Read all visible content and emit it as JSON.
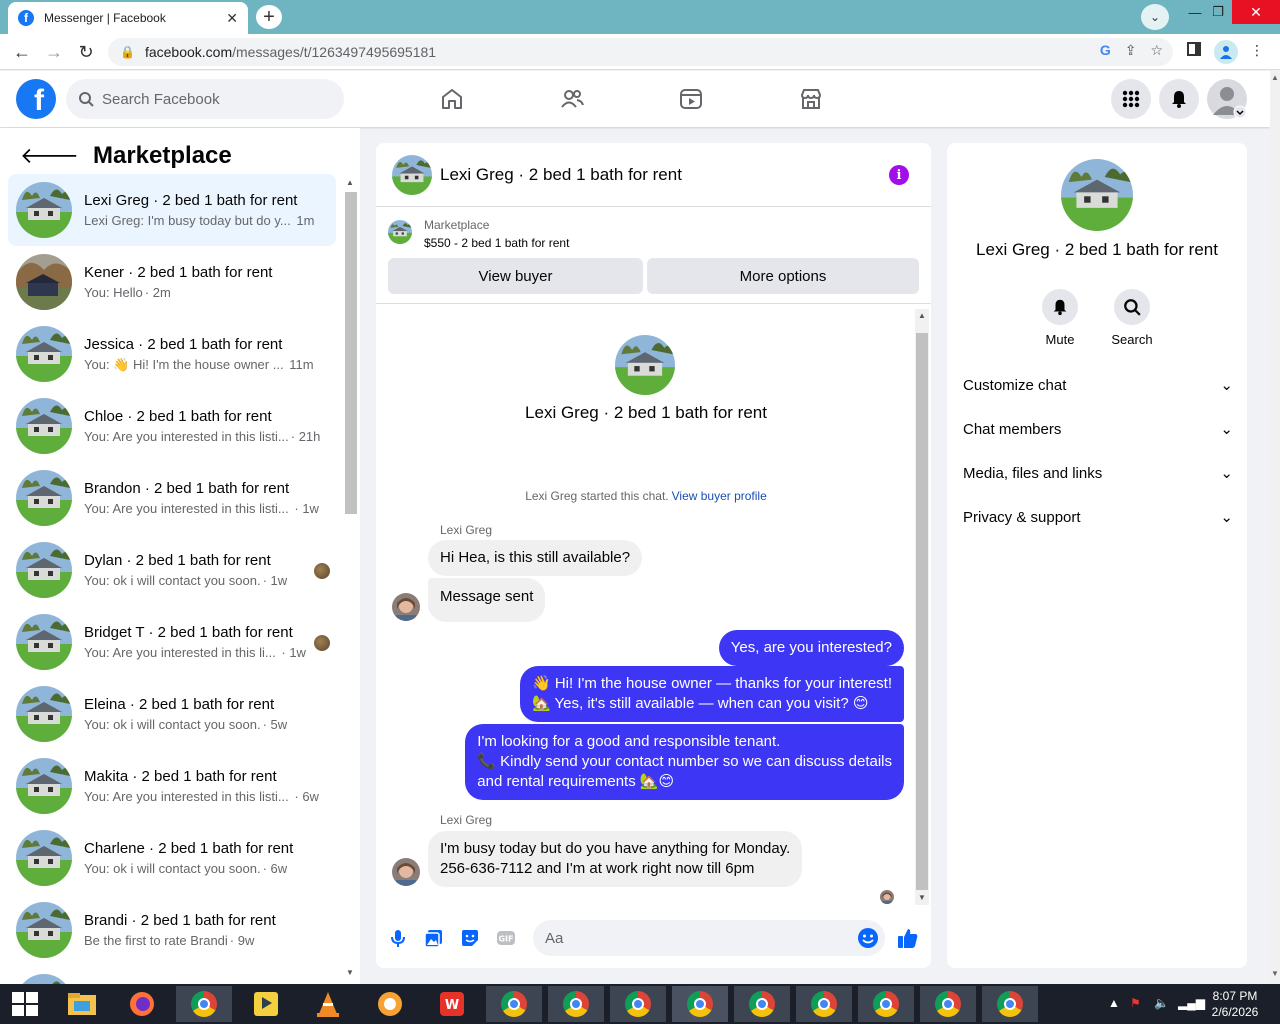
{
  "browser": {
    "tab_title": "Messenger | Facebook",
    "url_host": "facebook.com",
    "url_path": "/messages/t/1263497495695181"
  },
  "fb": {
    "search_placeholder": "Search Facebook"
  },
  "left": {
    "title": "Marketplace",
    "conversations": [
      {
        "name": "Lexi Greg · 2 bed 1 bath for rent",
        "snippet": "Lexi Greg: I'm busy today but do y...",
        "time": "1m"
      },
      {
        "name": "Kener · 2 bed 1 bath for rent",
        "snippet": "You: Hello",
        "time": "· 2m"
      },
      {
        "name": "Jessica · 2 bed 1 bath for rent",
        "snippet": "You: 👋 Hi! I'm the house owner ...",
        "time": "11m"
      },
      {
        "name": "Chloe · 2 bed 1 bath for rent",
        "snippet": "You: Are you interested in this listi...",
        "time": "· 21h"
      },
      {
        "name": "Brandon · 2 bed 1 bath for rent",
        "snippet": "You: Are you interested in this listi...",
        "time": "· 1w"
      },
      {
        "name": "Dylan · 2 bed 1 bath for rent",
        "snippet": "You: ok i will contact you soon.",
        "time": "· 1w"
      },
      {
        "name": "Bridget T · 2 bed 1 bath for rent",
        "snippet": "You: Are you interested in this li...",
        "time": "· 1w"
      },
      {
        "name": "Eleina · 2 bed 1 bath for rent",
        "snippet": "You: ok i will contact you soon.",
        "time": "· 5w"
      },
      {
        "name": "Makita · 2 bed 1 bath for rent",
        "snippet": "You: Are you interested in this listi...",
        "time": "· 6w"
      },
      {
        "name": "Charlene · 2 bed 1 bath for rent",
        "snippet": "You: ok i will contact you soon.",
        "time": "· 6w"
      },
      {
        "name": "Brandi · 2 bed 1 bath for rent",
        "snippet": "Be the first to rate Brandi",
        "time": "· 9w"
      }
    ]
  },
  "chat": {
    "header_name": "Lexi Greg · 2 bed 1 bath for rent",
    "marketplace_label": "Marketplace",
    "listing": "$550 - 2 bed 1 bath for rent",
    "view_buyer": "View buyer",
    "more_options": "More options",
    "center_name": "Lexi Greg · 2 bed 1 bath for rent",
    "started_note": "Lexi Greg started this chat.",
    "view_buyer_profile": "View buyer profile",
    "sender1": "Lexi Greg",
    "msg1": "Hi Hea, is this still available?",
    "msg2": "Message sent",
    "out1": "Yes, are you interested?",
    "out2_l1": "👋 Hi! I'm the house owner — thanks for your interest!",
    "out2_l2": "🏡 Yes, it's still available — when can you visit? 😊",
    "out3_l1": "I'm looking for a good and responsible tenant.",
    "out3_l2": "📞 Kindly send your contact number so we can discuss details",
    "out3_l3": "and rental requirements 🏡😊",
    "sender2": "Lexi Greg",
    "in3_l1": "I'm busy today but do you have anything for Monday.",
    "in3_l2": "256-636-7112 and I'm at work right now till 6pm",
    "composer_placeholder": "Aa"
  },
  "right": {
    "name": "Lexi Greg · 2 bed 1 bath for rent",
    "mute": "Mute",
    "search": "Search",
    "rows": [
      "Customize chat",
      "Chat members",
      "Media, files and links",
      "Privacy & support"
    ]
  },
  "taskbar": {
    "time": "8:07 PM",
    "date": "2/6/2026"
  },
  "colors": {
    "fb_blue": "#1877f2",
    "outgoing_bubble": "#3d37f5",
    "info_purple": "#a20ee8",
    "active_conv": "#ebf5ff"
  }
}
